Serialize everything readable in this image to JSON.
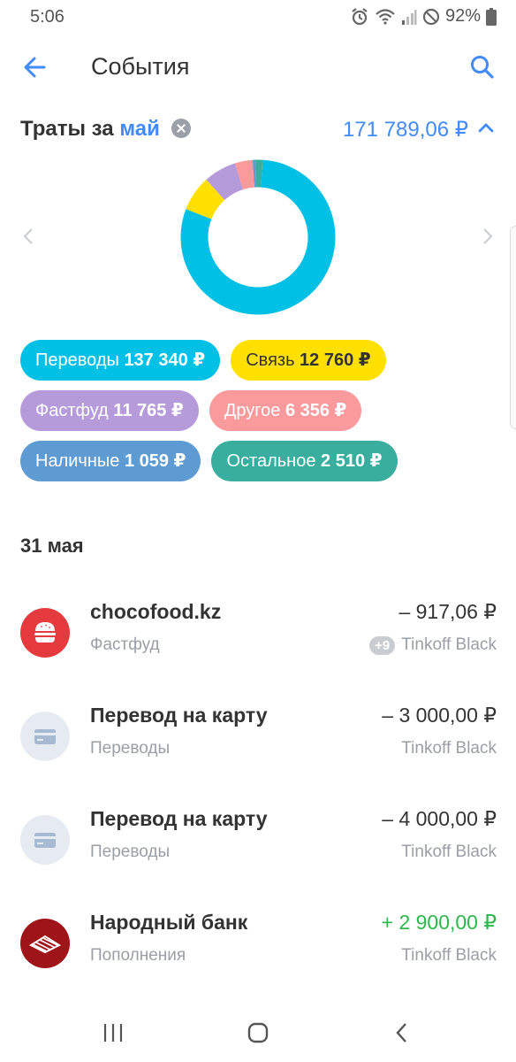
{
  "status_bar": {
    "time": "5:06",
    "battery": "92%"
  },
  "header": {
    "title": "События"
  },
  "summary": {
    "label_prefix": "Траты за",
    "month": "май",
    "total": "171 789,06 ₽"
  },
  "chart_data": {
    "type": "pie",
    "categories": [
      "Переводы",
      "Связь",
      "Фастфуд",
      "Другое",
      "Наличные",
      "Остальное"
    ],
    "values": [
      137340,
      12760,
      11765,
      6356,
      1059,
      2510
    ],
    "colors": [
      "#00c0e5",
      "#ffe000",
      "#b69bdb",
      "#fb9a9c",
      "#5f9bd3",
      "#3aae9e"
    ]
  },
  "chips": [
    {
      "label": "Переводы",
      "amount": "137 340 ₽",
      "color": "#00c0e5",
      "text_color": "#ffffff"
    },
    {
      "label": "Связь",
      "amount": "12 760 ₽",
      "color": "#ffe000",
      "text_color": "#333333"
    },
    {
      "label": "Фастфуд",
      "amount": "11 765 ₽",
      "color": "#b69bdb",
      "text_color": "#ffffff"
    },
    {
      "label": "Другое",
      "amount": "6 356 ₽",
      "color": "#fb9a9c",
      "text_color": "#ffffff"
    },
    {
      "label": "Наличные",
      "amount": "1 059 ₽",
      "color": "#5f9bd3",
      "text_color": "#ffffff"
    },
    {
      "label": "Остальное",
      "amount": "2 510 ₽",
      "color": "#3aae9e",
      "text_color": "#ffffff"
    }
  ],
  "date_group": "31 мая",
  "transactions": [
    {
      "title": "chocofood.kz",
      "category": "Фастфуд",
      "amount": "– 917,06 ₽",
      "card": "Tinkoff Black",
      "badge": "+9",
      "icon": "burger-icon"
    },
    {
      "title": "Перевод на карту",
      "category": "Переводы",
      "amount": "– 3 000,00 ₽",
      "card": "Tinkoff Black",
      "icon": "card-icon"
    },
    {
      "title": "Перевод на карту",
      "category": "Переводы",
      "amount": "– 4 000,00 ₽",
      "card": "Tinkoff Black",
      "icon": "card-icon"
    },
    {
      "title": "Народный банк",
      "category": "Пополнения",
      "amount": "+ 2 900,00 ₽",
      "card": "Tinkoff Black",
      "icon": "halyk-bank-logo"
    }
  ]
}
